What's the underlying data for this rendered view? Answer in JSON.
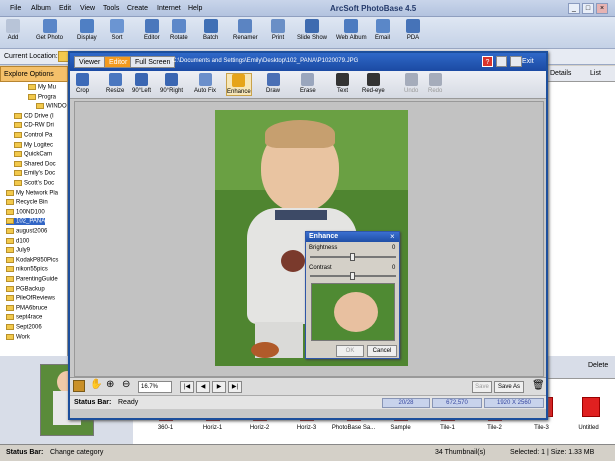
{
  "app": {
    "title": "ArcSoft PhotoBase 4.5"
  },
  "menu": [
    "File",
    "Album",
    "Edit",
    "View",
    "Tools",
    "Create",
    "Internet",
    "Help"
  ],
  "window_controls": [
    "_",
    "□",
    "×"
  ],
  "toolbar": [
    {
      "label": "Add",
      "icon": "add-icon"
    },
    {
      "label": "Get Photo",
      "icon": "camera-icon"
    },
    {
      "label": "Display",
      "icon": "display-icon"
    },
    {
      "label": "Sort",
      "icon": "sort-icon"
    },
    {
      "label": "Editor",
      "icon": "editor-icon"
    },
    {
      "label": "Rotate",
      "icon": "rotate-icon"
    },
    {
      "label": "Batch",
      "icon": "batch-icon"
    },
    {
      "label": "Renamer",
      "icon": "renamer-icon"
    },
    {
      "label": "Print",
      "icon": "print-icon"
    },
    {
      "label": "Slide Show",
      "icon": "slideshow-icon"
    },
    {
      "label": "Web Album",
      "icon": "web-album-icon"
    },
    {
      "label": "Email",
      "icon": "email-icon"
    },
    {
      "label": "PDA",
      "icon": "pda-icon"
    }
  ],
  "location": {
    "label": "Current Location:"
  },
  "explore": {
    "label": "Explore Options"
  },
  "tree": [
    "My Mu",
    "Progra",
    "WINDO",
    "CD Drive (I",
    "CD-RW Dri",
    "Control Pa",
    "My Logitec",
    "QuickCam",
    "Shared Doc",
    "Emily's Doc",
    "Scott's Doc",
    "My Network Pla",
    "Recycle Bin",
    "100ND100",
    "102_PANA",
    "august2006",
    "d100",
    "July9",
    "KodakP850Pics",
    "nikon55pics",
    "ParentingGuide",
    "PGBackup",
    "PileOfReviews",
    "PMA6bruce",
    "sept4race",
    "Sept2006",
    "Work"
  ],
  "viewer": {
    "tabs": [
      "Viewer",
      "Editor",
      "Full Screen"
    ],
    "path": "C:\\Documents and Settings\\Emily\\Desktop\\102_PANA\\P1020079.JPG",
    "exit": "Exit",
    "tools": [
      "Crop",
      "Resize",
      "90°Left",
      "90°Right",
      "Auto Fix",
      "Enhance",
      "Draw",
      "Erase",
      "Text",
      "Red-eye",
      "Undo",
      "Redo"
    ],
    "zoom": "16.7%",
    "save": "Save",
    "save_as": "Save As",
    "status_label": "Status Bar:",
    "status_value": "Ready",
    "index": "20/28",
    "size": "672,570",
    "dims": "1920 X 2560"
  },
  "enhance": {
    "title": "Enhance",
    "brightness_label": "Brightness",
    "brightness_value": "0",
    "contrast_label": "Contrast",
    "contrast_value": "0",
    "ok": "OK",
    "cancel": "Cancel"
  },
  "right_panel": {
    "details": "Details",
    "list": "List",
    "delete": "Delete"
  },
  "thumbnails": [
    "360-1",
    "Horiz-1",
    "Horiz-2",
    "Horiz-3",
    "PhotoBase Sa...",
    "Sample",
    "Tile-1",
    "Tile-2",
    "Tile-3",
    "Untitled"
  ],
  "statusbar": {
    "label": "Status Bar:",
    "value": "Change category",
    "thumbs": "34 Thumbnail(s)",
    "selected": "Selected: 1 | Size: 1.33 MB"
  }
}
